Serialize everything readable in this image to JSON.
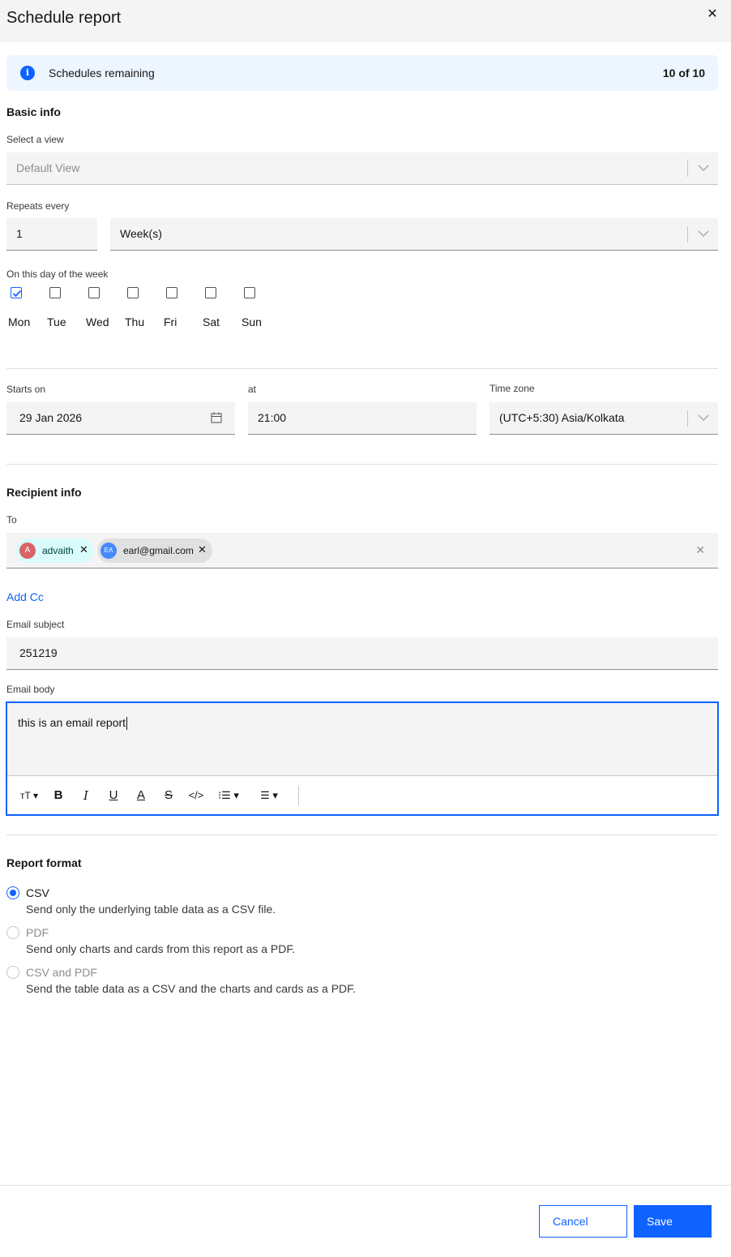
{
  "dialog": {
    "title": "Schedule report",
    "close_icon": "close-icon"
  },
  "banner": {
    "label": "Schedules remaining",
    "count": "10 of 10",
    "icon": "info-icon"
  },
  "basic_info": {
    "section_title": "Basic info",
    "view_label": "Select a view",
    "view_value": "Default View",
    "repeats_label": "Repeats every",
    "repeats_value": "1",
    "repeats_unit": "Week(s)",
    "days_label": "On this day of the week",
    "days": [
      {
        "label": "Mon",
        "checked": true
      },
      {
        "label": "Tue",
        "checked": false
      },
      {
        "label": "Wed",
        "checked": false
      },
      {
        "label": "Thu",
        "checked": false
      },
      {
        "label": "Fri",
        "checked": false
      },
      {
        "label": "Sat",
        "checked": false
      },
      {
        "label": "Sun",
        "checked": false
      }
    ]
  },
  "schedule": {
    "starts_label": "Starts on",
    "starts_value": "29 Jan 2026",
    "at_label": "at",
    "at_value": "21:00",
    "tz_label": "Time zone",
    "tz_value": "(UTC+5:30) Asia/Kolkata"
  },
  "recipient": {
    "section_title": "Recipient info",
    "to_label": "To",
    "tags": [
      {
        "initials": "A",
        "text": "advaith"
      },
      {
        "initials": "EA",
        "text": "earl@gmail.com"
      }
    ],
    "add_cc": "Add Cc",
    "subject_label": "Email subject",
    "subject_value": "251219",
    "body_label": "Email body",
    "body_value": "this is an email report"
  },
  "format": {
    "section_title": "Report format",
    "options": [
      {
        "label": "CSV",
        "desc": "Send only the underlying table data as a CSV file.",
        "selected": true
      },
      {
        "label": "PDF",
        "desc": "Send only charts and cards from this report as a PDF.",
        "selected": false
      },
      {
        "label": "CSV and PDF",
        "desc": "Send the table data as a CSV and the charts and cards as a PDF.",
        "selected": false
      }
    ]
  },
  "footer": {
    "cancel": "Cancel",
    "save": "Save"
  },
  "colors": {
    "primary": "#0f62fe",
    "field_bg": "#f4f4f4",
    "banner_bg": "#edf5ff"
  }
}
